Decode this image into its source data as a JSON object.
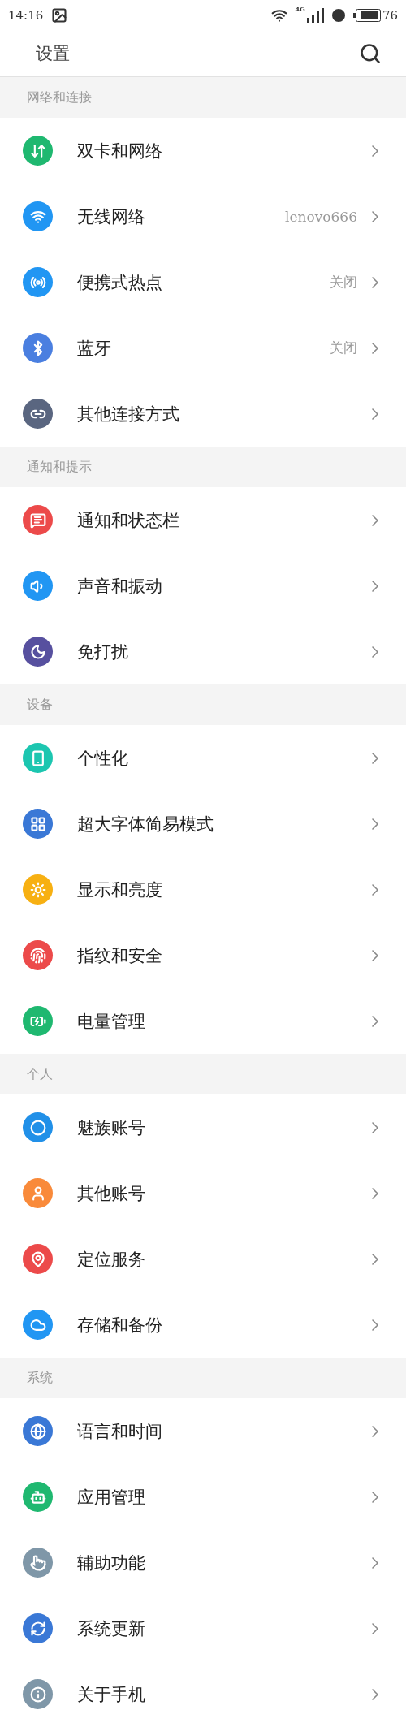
{
  "status_bar": {
    "time": "14:16",
    "network_type": "4G",
    "battery": "76"
  },
  "header": {
    "title": "设置"
  },
  "sections": [
    {
      "title": "网络和连接",
      "items": [
        {
          "label": "双卡和网络",
          "color": "#1fb870"
        },
        {
          "label": "无线网络",
          "value": "lenovo666",
          "color": "#2196f3"
        },
        {
          "label": "便携式热点",
          "value": "关闭",
          "color": "#2196f3"
        },
        {
          "label": "蓝牙",
          "value": "关闭",
          "color": "#4a7fe0"
        },
        {
          "label": "其他连接方式",
          "color": "#5a6680"
        }
      ]
    },
    {
      "title": "通知和提示",
      "items": [
        {
          "label": "通知和状态栏",
          "color": "#ec4a4a"
        },
        {
          "label": "声音和振动",
          "color": "#2196f3"
        },
        {
          "label": "免打扰",
          "color": "#57509f"
        }
      ]
    },
    {
      "title": "设备",
      "items": [
        {
          "label": "个性化",
          "color": "#1cc6b0"
        },
        {
          "label": "超大字体简易模式",
          "color": "#3a78d6"
        },
        {
          "label": "显示和亮度",
          "color": "#f7b012"
        },
        {
          "label": "指纹和安全",
          "color": "#ec4a4a"
        },
        {
          "label": "电量管理",
          "color": "#1fb870"
        }
      ]
    },
    {
      "title": "个人",
      "items": [
        {
          "label": "魅族账号",
          "color": "#2190e8"
        },
        {
          "label": "其他账号",
          "color": "#f98a3a"
        },
        {
          "label": "定位服务",
          "color": "#ec4a4a"
        },
        {
          "label": "存储和备份",
          "color": "#2196f3"
        }
      ]
    },
    {
      "title": "系统",
      "items": [
        {
          "label": "语言和时间",
          "color": "#3a78d6"
        },
        {
          "label": "应用管理",
          "color": "#1fb870"
        },
        {
          "label": "辅助功能",
          "color": "#7f97a8"
        },
        {
          "label": "系统更新",
          "color": "#3a78d6"
        },
        {
          "label": "关于手机",
          "color": "#7f97a8"
        }
      ]
    }
  ]
}
